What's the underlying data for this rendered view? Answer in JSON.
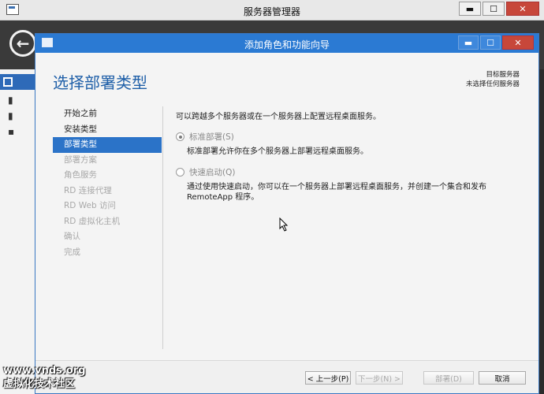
{
  "outer_window": {
    "title": "服务器管理器",
    "controls": {
      "minimize": "▬",
      "maximize": "☐",
      "close": "✕"
    },
    "back_glyph": "←"
  },
  "wizard": {
    "title": "添加角色和功能向导",
    "controls": {
      "minimize": "▬",
      "maximize": "☐",
      "close": "✕"
    },
    "page_title": "选择部署类型",
    "destination": {
      "label": "目标服务器",
      "value": "未选择任何服务器"
    },
    "nav_items": [
      {
        "label": "开始之前",
        "state": "normal"
      },
      {
        "label": "安装类型",
        "state": "normal"
      },
      {
        "label": "部署类型",
        "state": "selected"
      },
      {
        "label": "部署方案",
        "state": "disabled"
      },
      {
        "label": "角色服务",
        "state": "disabled"
      },
      {
        "label": "RD 连接代理",
        "state": "disabled"
      },
      {
        "label": "RD Web 访问",
        "state": "disabled"
      },
      {
        "label": "RD 虚拟化主机",
        "state": "disabled"
      },
      {
        "label": "确认",
        "state": "disabled"
      },
      {
        "label": "完成",
        "state": "disabled"
      }
    ],
    "intro": "可以跨越多个服务器或在一个服务器上配置远程桌面服务。",
    "options": [
      {
        "label": "标准部署(S)",
        "checked": true,
        "description": "标准部署允许你在多个服务器上部署远程桌面服务。"
      },
      {
        "label": "快速启动(Q)",
        "checked": false,
        "description": "通过使用快速启动，你可以在一个服务器上部署远程桌面服务，并创建一个集合和发布 RemoteApp 程序。"
      }
    ],
    "buttons": {
      "prev": "< 上一步(P)",
      "next": "下一步(N) >",
      "deploy": "部署(D)",
      "cancel": "取消"
    }
  },
  "watermark": {
    "line1": "www.vnds.org",
    "line2": "虚拟化技术社区"
  },
  "colors": {
    "accent": "#2b73c8",
    "title_blue": "#1f5fa8",
    "close_red": "#c7473a"
  }
}
